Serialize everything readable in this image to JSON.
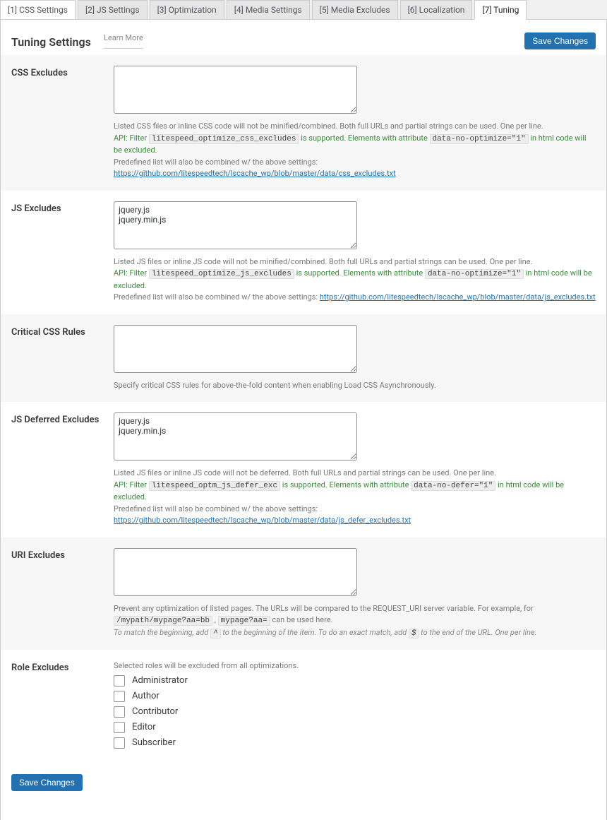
{
  "tabs": [
    {
      "label": "[1] CSS Settings"
    },
    {
      "label": "[2] JS Settings"
    },
    {
      "label": "[3] Optimization"
    },
    {
      "label": "[4] Media Settings"
    },
    {
      "label": "[5] Media Excludes"
    },
    {
      "label": "[6] Localization"
    },
    {
      "label": "[7] Tuning"
    }
  ],
  "header": {
    "title": "Tuning Settings",
    "learn_more": "Learn More"
  },
  "buttons": {
    "save": "Save Changes"
  },
  "rows": {
    "css_excludes": {
      "label": "CSS Excludes",
      "value": "",
      "desc_line1": "Listed CSS files or inline CSS code will not be minified/combined. Both full URLs and partial strings can be used. One per line.",
      "api_prefix": "API: Filter ",
      "api_filter": "litespeed_optimize_css_excludes",
      "api_mid": " is supported. Elements with attribute ",
      "api_attr": "data-no-optimize=\"1\"",
      "api_suffix": " in html code will be excluded.",
      "predefined_prefix": "Predefined list will also be combined w/ the above settings: ",
      "predefined_link": "https://github.com/litespeedtech/lscache_wp/blob/master/data/css_excludes.txt"
    },
    "js_excludes": {
      "label": "JS Excludes",
      "value": "jquery.js\njquery.min.js",
      "desc_line1": "Listed JS files or inline JS code will not be minified/combined. Both full URLs and partial strings can be used. One per line.",
      "api_prefix": "API: Filter ",
      "api_filter": "litespeed_optimize_js_excludes",
      "api_mid": " is supported. Elements with attribute ",
      "api_attr": "data-no-optimize=\"1\"",
      "api_suffix": " in html code will be excluded.",
      "predefined_prefix": "Predefined list will also be combined w/ the above settings: ",
      "predefined_link": "https://github.com/litespeedtech/lscache_wp/blob/master/data/js_excludes.txt"
    },
    "critical_css": {
      "label": "Critical CSS Rules",
      "value": "",
      "desc_line1": "Specify critical CSS rules for above-the-fold content when enabling Load CSS Asynchronously."
    },
    "js_deferred": {
      "label": "JS Deferred Excludes",
      "value": "jquery.js\njquery.min.js",
      "desc_line1": "Listed JS files or inline JS code will not be deferred. Both full URLs and partial strings can be used. One per line.",
      "api_prefix": "API: Filter ",
      "api_filter": "litespeed_optm_js_defer_exc",
      "api_mid": " is supported. Elements with attribute ",
      "api_attr": "data-no-defer=\"1\"",
      "api_suffix": " in html code will be excluded.",
      "predefined_prefix": "Predefined list will also be combined w/ the above settings: ",
      "predefined_link": "https://github.com/litespeedtech/lscache_wp/blob/master/data/js_defer_excludes.txt"
    },
    "uri_excludes": {
      "label": "URI Excludes",
      "value": "",
      "desc_line1_a": "Prevent any optimization of listed pages. The URLs will be compared to the REQUEST_URI server variable. For example, for ",
      "code1": "/mypath/mypage?aa=bb",
      "desc_line1_b": " , ",
      "code2": "mypage?aa=",
      "desc_line1_c": " can be used here.",
      "em_a": "To match the beginning, add ",
      "code3": "^",
      "em_b": " to the beginning of the item. To do an exact match, add ",
      "code4": "$",
      "em_c": " to the end of the URL. One per line."
    },
    "role_excludes": {
      "label": "Role Excludes",
      "desc": "Selected roles will be excluded from all optimizations.",
      "roles": [
        "Administrator",
        "Author",
        "Contributor",
        "Editor",
        "Subscriber"
      ]
    }
  }
}
